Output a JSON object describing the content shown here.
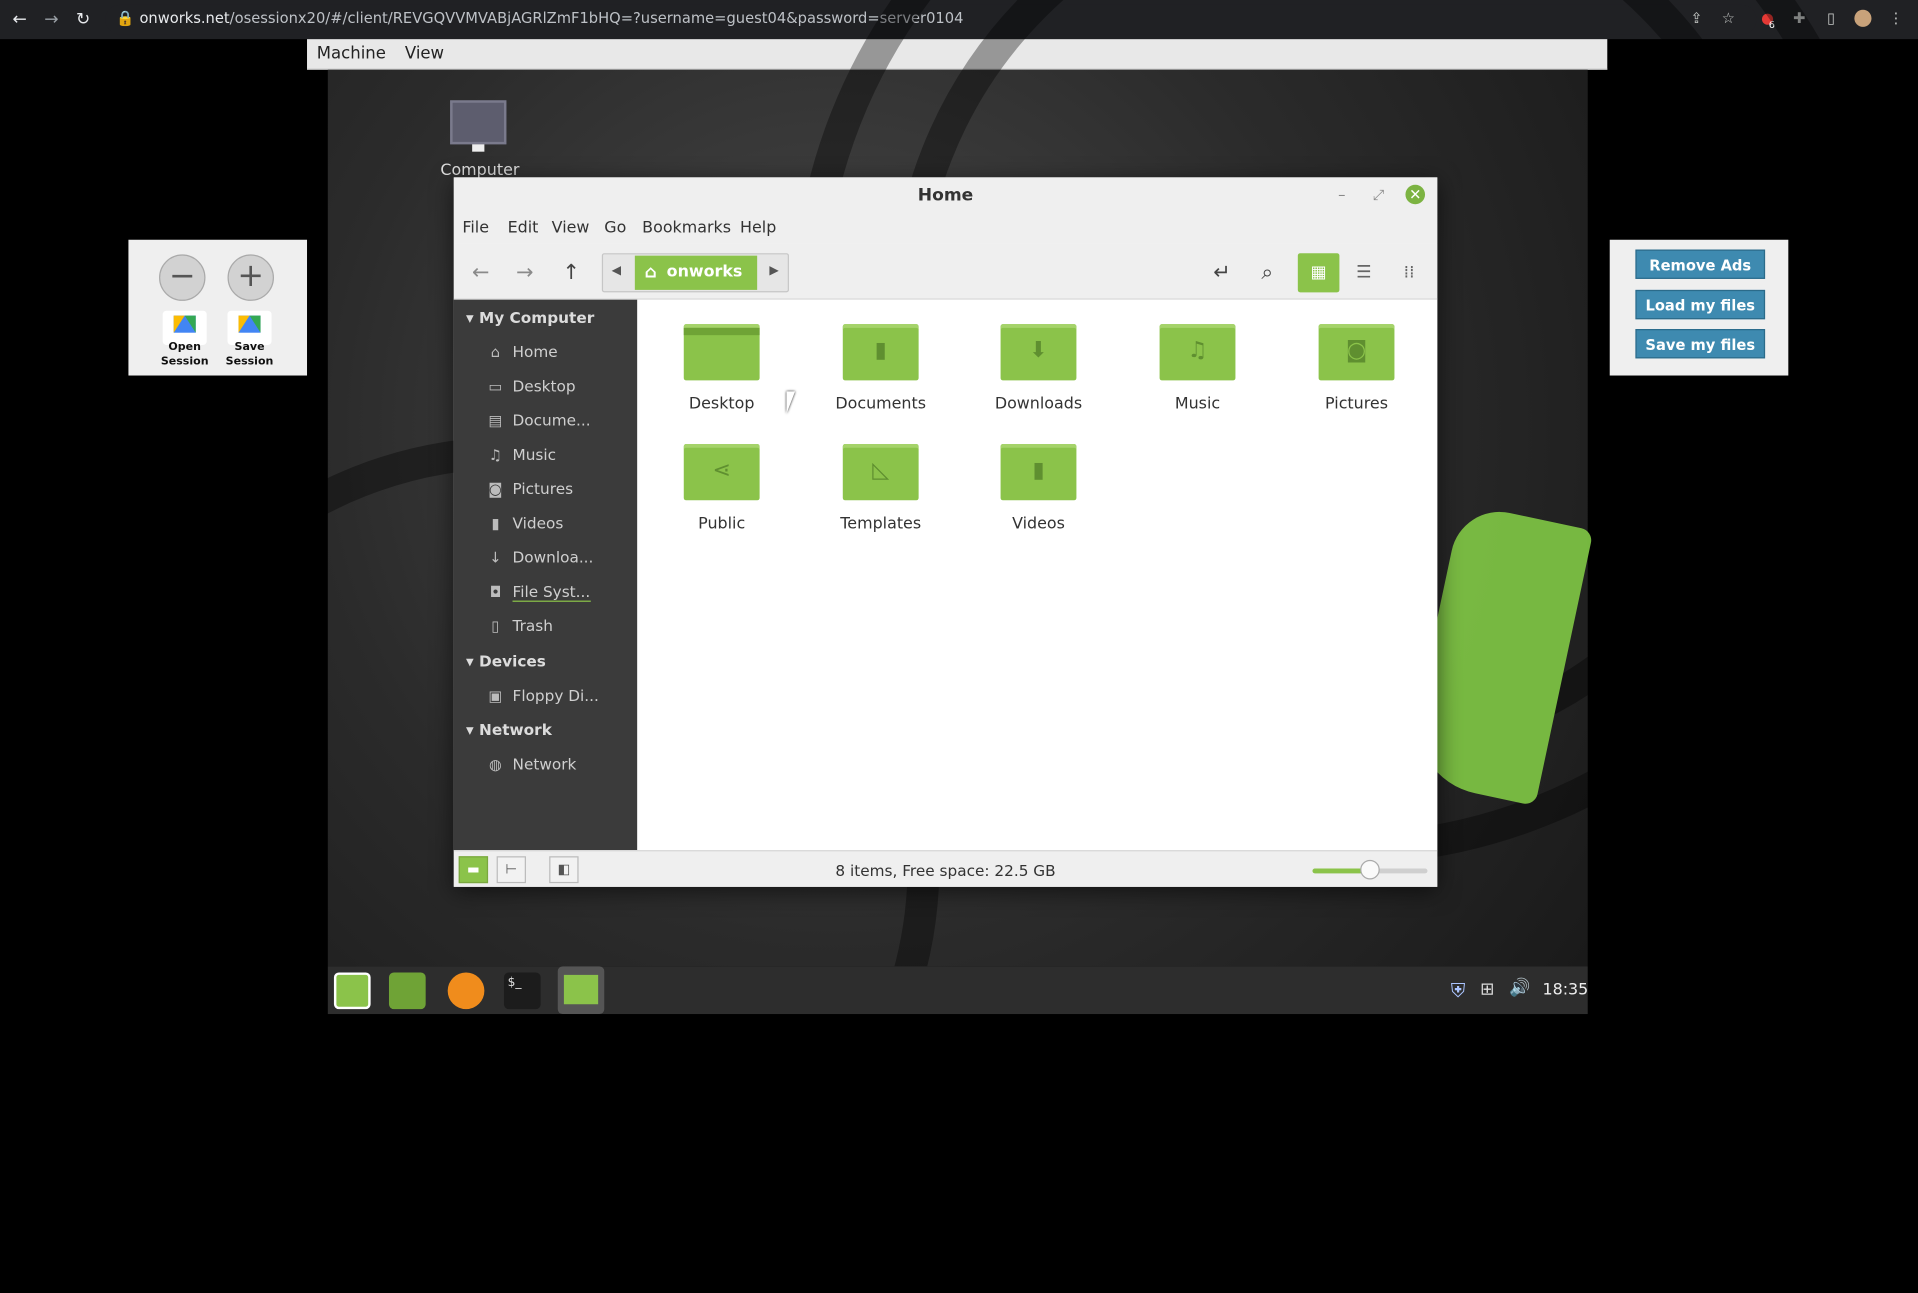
{
  "browser": {
    "url_domain": "onworks.net",
    "url_path": "/osessionx20/#/client/REVGQVVMVABjAGRlZmF1bHQ=?username=guest04&password=server0104",
    "badge_count": "6",
    "icons": [
      "back-icon",
      "forward-icon",
      "reload-icon",
      "lock-icon",
      "share-icon",
      "star-icon",
      "extension-icon",
      "puzzle-icon",
      "sidepanel-icon",
      "profile-icon",
      "more-icon"
    ]
  },
  "vm_menu": {
    "machine": "Machine",
    "view": "View"
  },
  "left_panel": {
    "zoom_out": "−",
    "zoom_in": "+",
    "open_session": "Open\nSession",
    "save_session": "Save\nSession"
  },
  "right_panel": {
    "remove_ads": "Remove Ads",
    "load_files": "Load my files",
    "save_files": "Save my files"
  },
  "desktop": {
    "computer_label": "Computer"
  },
  "window": {
    "title": "Home",
    "menu": [
      "File",
      "Edit",
      "View",
      "Go",
      "Bookmarks",
      "Help"
    ],
    "breadcrumb": "onworks",
    "sidebar": {
      "sections": [
        {
          "title": "My Computer",
          "items": [
            {
              "label": "Home",
              "icon": "home-icon"
            },
            {
              "label": "Desktop",
              "icon": "desktop-icon"
            },
            {
              "label": "Docume...",
              "icon": "document-icon"
            },
            {
              "label": "Music",
              "icon": "music-icon"
            },
            {
              "label": "Pictures",
              "icon": "camera-icon"
            },
            {
              "label": "Videos",
              "icon": "film-icon"
            },
            {
              "label": "Downloa...",
              "icon": "download-icon"
            },
            {
              "label": "File Syst...",
              "icon": "drive-icon"
            },
            {
              "label": "Trash",
              "icon": "trash-icon"
            }
          ]
        },
        {
          "title": "Devices",
          "items": [
            {
              "label": "Floppy Di...",
              "icon": "floppy-icon"
            }
          ]
        },
        {
          "title": "Network",
          "items": [
            {
              "label": "Network",
              "icon": "network-icon"
            }
          ]
        }
      ]
    },
    "folders": [
      {
        "label": "Desktop",
        "icon": "desktop-folder-icon"
      },
      {
        "label": "Documents",
        "icon": "documents-folder-icon"
      },
      {
        "label": "Downloads",
        "icon": "downloads-folder-icon"
      },
      {
        "label": "Music",
        "icon": "music-folder-icon"
      },
      {
        "label": "Pictures",
        "icon": "pictures-folder-icon"
      },
      {
        "label": "Public",
        "icon": "public-folder-icon"
      },
      {
        "label": "Templates",
        "icon": "templates-folder-icon"
      },
      {
        "label": "Videos",
        "icon": "videos-folder-icon"
      }
    ],
    "status": "8 items, Free space: 22.5 GB",
    "zoom_level": 0.5
  },
  "taskbar": {
    "clock": "18:35"
  },
  "colors": {
    "accent": "#8bc34a",
    "ad_button": "#3e8ab0",
    "sidebar_bg": "#3b3b3b"
  }
}
